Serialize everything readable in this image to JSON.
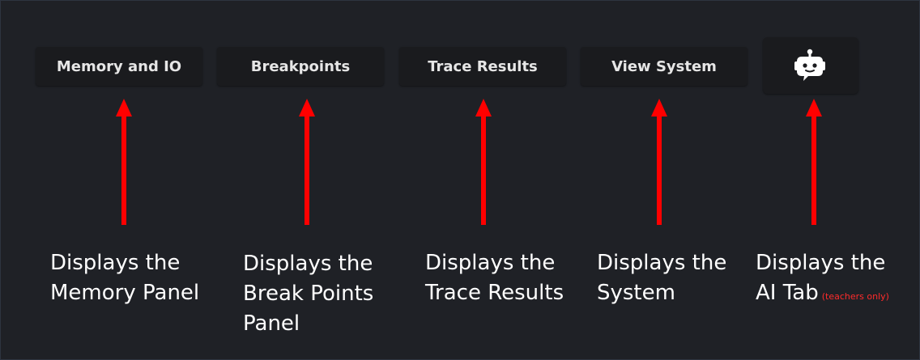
{
  "toolbar": {
    "memory_label": "Memory and IO",
    "breakpoints_label": "Breakpoints",
    "trace_label": "Trace Results",
    "view_system_label": "View System",
    "ai_icon": "robot-chat-icon"
  },
  "captions": {
    "memory": [
      "Displays the",
      "Memory Panel"
    ],
    "breakpoints": [
      "Displays the",
      "Break Points",
      "Panel"
    ],
    "trace": [
      "Displays the",
      "Trace Results"
    ],
    "system": [
      "Displays the",
      "System"
    ],
    "ai": [
      "Displays the",
      "AI Tab"
    ],
    "ai_note": "(teachers only)"
  },
  "colors": {
    "background": "#1f2126",
    "button": "#1a1b1e",
    "button_text": "#e6e6e6",
    "arrow": "#ff0000",
    "caption": "#ffffff",
    "note": "#ff2b2b"
  }
}
